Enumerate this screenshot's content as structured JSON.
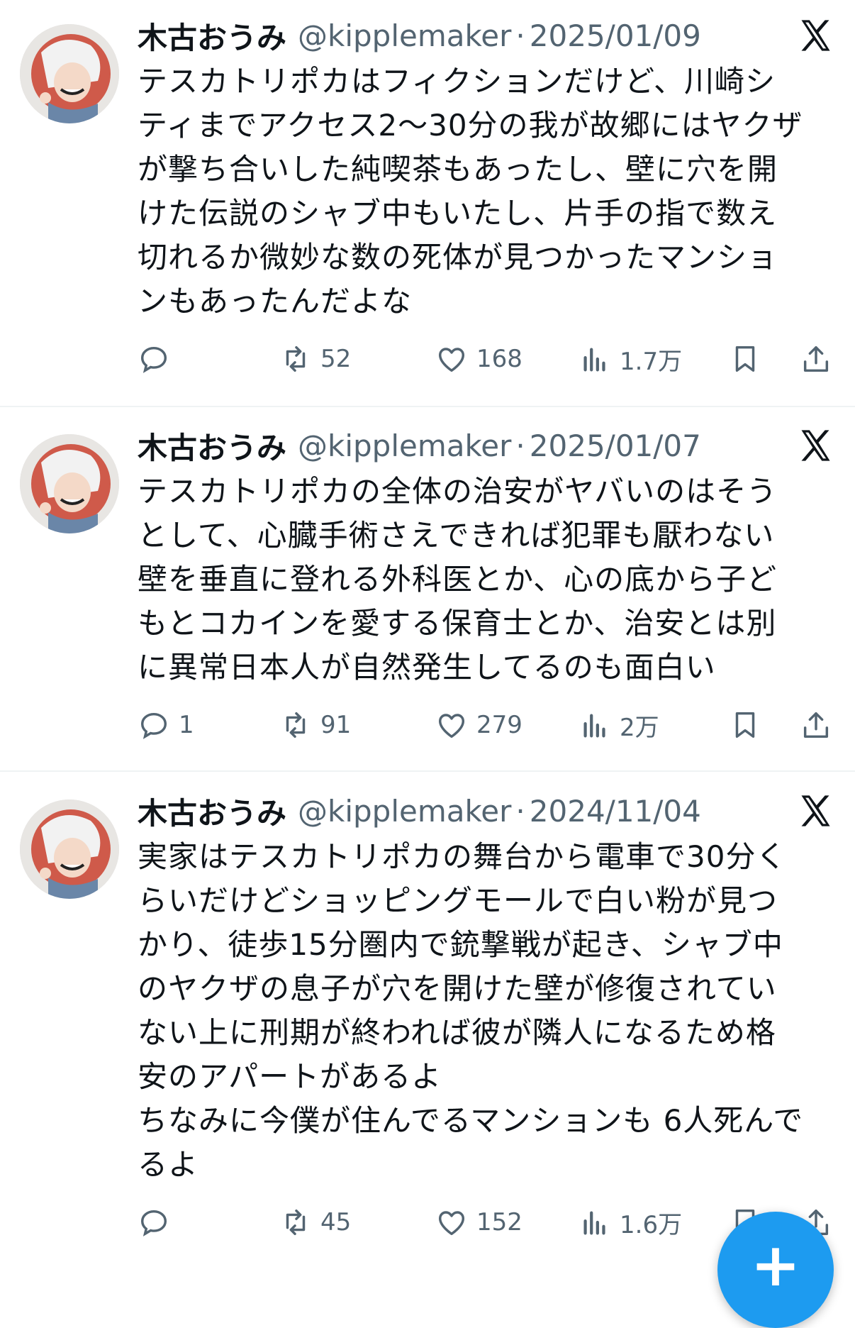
{
  "tweets": [
    {
      "display_name": "木古おうみ",
      "handle": "@kipplemaker",
      "separator": "·",
      "date": "2025/01/09",
      "lines": [
        "テスカトリポカはフィクションだけど、川崎シ",
        "ティまでアクセス2〜30分の我が故郷にはヤクザ",
        "が撃ち合いした純喫茶もあったし、壁に穴を開",
        "けた伝説のシャブ中もいたし、片手の指で数え",
        "切れるか微妙な数の死体が見つかったマンショ",
        "ンもあったんだよな"
      ],
      "replies": "",
      "reposts": "52",
      "likes": "168",
      "views": "1.7万"
    },
    {
      "display_name": "木古おうみ",
      "handle": "@kipplemaker",
      "separator": "·",
      "date": "2025/01/07",
      "lines": [
        "テスカトリポカの全体の治安がヤバいのはそう",
        "として、心臓手術さえできれば犯罪も厭わない",
        "壁を垂直に登れる外科医とか、心の底から子ど",
        "もとコカインを愛する保育士とか、治安とは別",
        "に異常日本人が自然発生してるのも面白い"
      ],
      "replies": "1",
      "reposts": "91",
      "likes": "279",
      "views": "2万"
    },
    {
      "display_name": "木古おうみ",
      "handle": "@kipplemaker",
      "separator": "·",
      "date": "2024/11/04",
      "lines": [
        "実家はテスカトリポカの舞台から電車で30分く",
        "らいだけどショッピングモールで白い粉が見つ",
        "かり、徒歩15分圏内で銃撃戦が起き、シャブ中",
        "のヤクザの息子が穴を開けた壁が修復されてい",
        "ない上に刑期が終われば彼が隣人になるため格",
        "安のアパートがあるよ",
        "ちなみに今僕が住んでるマンションも 6人死んで",
        "るよ"
      ],
      "replies": "",
      "reposts": "45",
      "likes": "152",
      "views": "1.6万"
    }
  ],
  "icons": {
    "x_logo": "x-logo-icon",
    "reply": "reply-icon",
    "repost": "repost-icon",
    "like": "heart-icon",
    "views": "views-bar-chart-icon",
    "bookmark": "bookmark-icon",
    "share": "share-icon",
    "compose": "compose-plus-icon"
  },
  "fab": {
    "label": "+"
  },
  "colors": {
    "text": "#0f1419",
    "secondary": "#536471",
    "accent": "#1d9bf0",
    "divider": "#eff3f4"
  }
}
